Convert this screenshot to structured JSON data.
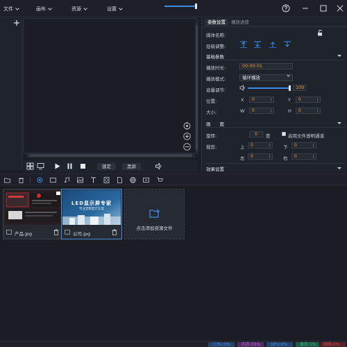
{
  "menu": {
    "items": [
      "文件",
      "画布",
      "资源",
      "设置"
    ]
  },
  "player": {
    "lock_label": "锁定",
    "blackscreen_label": "黑屏",
    "volume_level": 1.0
  },
  "props": {
    "tabs": [
      "参数设置",
      "播放进度"
    ],
    "media_name_label": "媒体名称:",
    "layer_label": "层级调整:",
    "basic_section": "基础参数",
    "duration_label": "播放时长:",
    "duration_value": "00:00:01",
    "mode_label": "播放模式:",
    "mode_value": "循环播放",
    "volume_label": "音量调节:",
    "volume_value": "100",
    "position_label": "位置:",
    "x_label": "X",
    "x_value": "0",
    "y_label": "Y",
    "y_value": "0",
    "size_label": "大小:",
    "w_label": "W",
    "w_value": "0",
    "h_label": "H",
    "h_value": "0",
    "picture_section": "画　　面",
    "rotate_label": "旋转:",
    "rotate_value": "0",
    "rotate_unit": "度",
    "transparent_label": "启用文件透明通道",
    "crop_label": "裁剪:",
    "crop_top_label": "上",
    "crop_top_value": "0",
    "crop_bottom_label": "下",
    "crop_bottom_value": "0",
    "crop_left_label": "左",
    "crop_left_value": "0",
    "crop_right_label": "右",
    "crop_right_value": "0",
    "effects_section": "效果设置"
  },
  "assets": {
    "items": [
      {
        "name": "产品.jpg"
      },
      {
        "name": "公司.jpg",
        "thumb_title": "LED显示屏专家",
        "thumb_sub": "专业定制显示方案"
      }
    ],
    "add_label": "点击添加资源文件"
  },
  "status": {
    "cpu": "CPU:5%",
    "memory": "内存:55%",
    "gpu": "GPU:0%",
    "disk": "显存:1%",
    "network": "网络:0%"
  },
  "colors": {
    "accent": "#3c8de8",
    "value": "#e6a23c",
    "background": "#1b1e26"
  }
}
